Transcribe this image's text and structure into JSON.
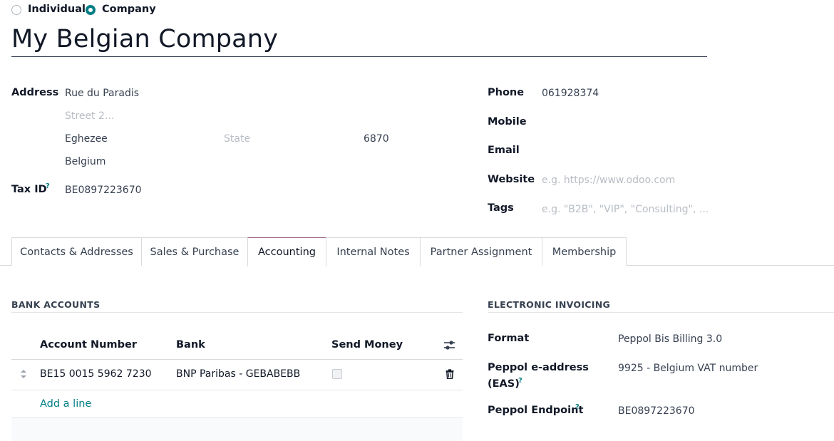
{
  "partner_type": {
    "individual_label": "Individual",
    "company_label": "Company",
    "selected": "Company"
  },
  "partner_name": "My Belgian Company",
  "address": {
    "label": "Address",
    "street": "Rue du Paradis",
    "street2_placeholder": "Street 2...",
    "city": "Eghezee",
    "state_placeholder": "State",
    "zip": "6870",
    "country": "Belgium"
  },
  "tax": {
    "label": "Tax ID",
    "help": "?",
    "value": "BE0897223670"
  },
  "contact": {
    "phone_label": "Phone",
    "phone_value": "061928374",
    "mobile_label": "Mobile",
    "email_label": "Email",
    "website_label": "Website",
    "website_placeholder": "e.g. https://www.odoo.com",
    "tags_label": "Tags",
    "tags_placeholder": "e.g. \"B2B\", \"VIP\", \"Consulting\", ..."
  },
  "tabs": [
    {
      "label": "Contacts & Addresses"
    },
    {
      "label": "Sales & Purchase"
    },
    {
      "label": "Accounting",
      "active": true
    },
    {
      "label": "Internal Notes"
    },
    {
      "label": "Partner Assignment"
    },
    {
      "label": "Membership"
    }
  ],
  "bank": {
    "title": "BANK ACCOUNTS",
    "col_account": "Account Number",
    "col_bank": "Bank",
    "col_send": "Send Money",
    "rows": [
      {
        "account": "BE15 0015 5962 7230",
        "bank": "BNP Paribas - GEBABEBB",
        "send_money": false
      }
    ],
    "add_line": "Add a line"
  },
  "einvoicing": {
    "title": "ELECTRONIC INVOICING",
    "format_label": "Format",
    "format_value": "Peppol Bis Billing 3.0",
    "eas_label_line1": "Peppol e-address",
    "eas_label_line2": "(EAS)",
    "eas_help": "?",
    "eas_value": "9925 - Belgium VAT number",
    "endpoint_label": "Peppol Endpoint",
    "endpoint_help": "?",
    "endpoint_value": "BE0897223670"
  },
  "colors": {
    "accent": "#017e84",
    "active_tab_top": "#a26b89"
  }
}
